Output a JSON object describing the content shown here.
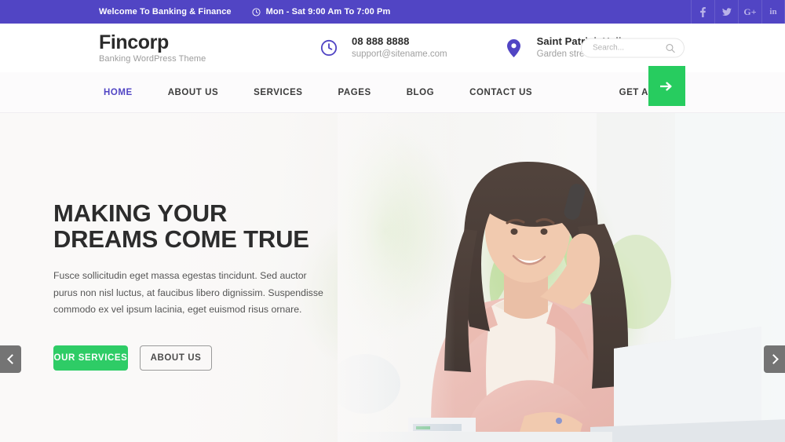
{
  "topbar": {
    "welcome": "Welcome To Banking & Finance",
    "hours": "Mon - Sat 9:00 Am To 7:00 Pm",
    "clock_icon": "clock-icon",
    "social": [
      {
        "name": "facebook-icon",
        "label": "f"
      },
      {
        "name": "twitter-icon",
        "label": "t"
      },
      {
        "name": "google-plus-icon",
        "label": "G+"
      },
      {
        "name": "linkedin-icon",
        "label": "in"
      }
    ],
    "bg_color": "#5145c4"
  },
  "header": {
    "brand_name": "Fincorp",
    "brand_tagline": "Banking WordPress Theme",
    "phone": "08 888 8888",
    "email": "support@sitename.com",
    "location_name": "Saint Patrick Hall",
    "location_address": "Garden street, California",
    "phone_icon": "clock-icon",
    "location_icon": "map-pin-icon",
    "search_placeholder": "Search...",
    "search_value": "",
    "search_icon": "search-icon"
  },
  "nav": {
    "items": [
      {
        "label": "HOME",
        "active": true
      },
      {
        "label": "ABOUT US",
        "active": false
      },
      {
        "label": "SERVICES",
        "active": false
      },
      {
        "label": "PAGES",
        "active": false
      },
      {
        "label": "BLOG",
        "active": false
      },
      {
        "label": "CONTACT US",
        "active": false
      }
    ],
    "quote_label": "GET A QUOTE",
    "quote_arrow_icon": "arrow-right-icon",
    "accent_color": "#5145c4",
    "green_color": "#27cc5f"
  },
  "hero": {
    "title_line1": "MAKING YOUR",
    "title_line2": "DREAMS COME TRUE",
    "description": "Fusce sollicitudin eget massa egestas tincidunt. Sed auctor purus non nisl luctus, at faucibus libero dignissim. Suspendisse commodo ex vel ipsum lacinia, eget euismod risus ornare.",
    "primary_button": "OUR SERVICES",
    "secondary_button": "ABOUT US",
    "prev_icon": "chevron-left-icon",
    "next_icon": "chevron-right-icon",
    "primary_color": "#2ecc66"
  }
}
